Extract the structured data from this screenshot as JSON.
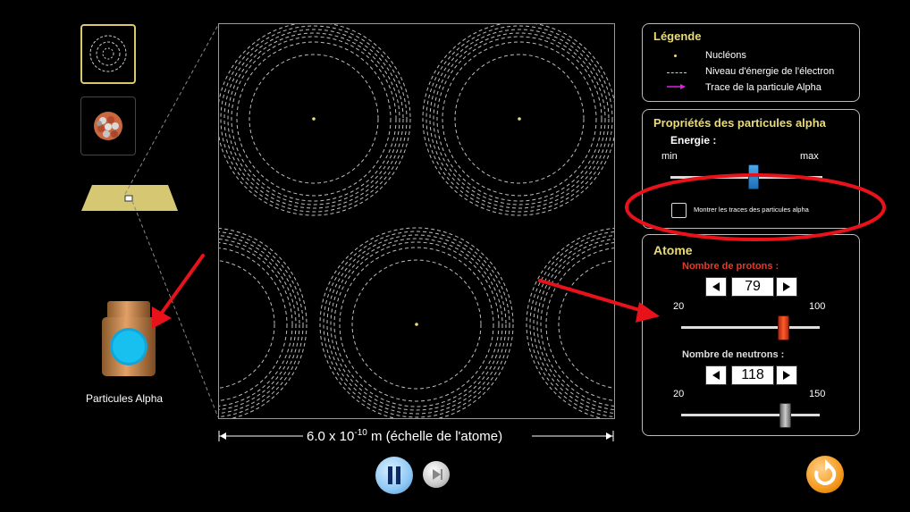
{
  "sidebar": {
    "source_label": "Particules Alpha"
  },
  "scale": {
    "prefix": "6.0 x 10",
    "exponent": "-10",
    "suffix": " m (échelle de l'atome)"
  },
  "legend": {
    "title": "Légende",
    "items": [
      {
        "label": "Nucléons",
        "icon": "nucleon-dot"
      },
      {
        "label": "Niveau d'énergie de l'électron",
        "icon": "dashed-line"
      },
      {
        "label": "Trace de la particule Alpha",
        "icon": "magenta-arrow"
      }
    ]
  },
  "alpha": {
    "title": "Propriétés des particules alpha",
    "energy_label": "Energie :",
    "min_label": "min",
    "max_label": "max",
    "energy_level": 0.5,
    "traces_label": "Montrer les traces des particules alpha",
    "traces_checked": false
  },
  "atom": {
    "title": "Atome",
    "protons_label": "Nombre de protons :",
    "protons_value": "79",
    "protons_min": "20",
    "protons_max": "100",
    "neutrons_label": "Nombre de neutrons :",
    "neutrons_value": "118",
    "neutrons_min": "20",
    "neutrons_max": "150"
  },
  "colors": {
    "panel_title": "#eadc7a",
    "protons_label": "#e23b2a",
    "annotation": "#e8121b",
    "play_button": "#8ec8f4",
    "reset_button": "#f59a1f"
  }
}
